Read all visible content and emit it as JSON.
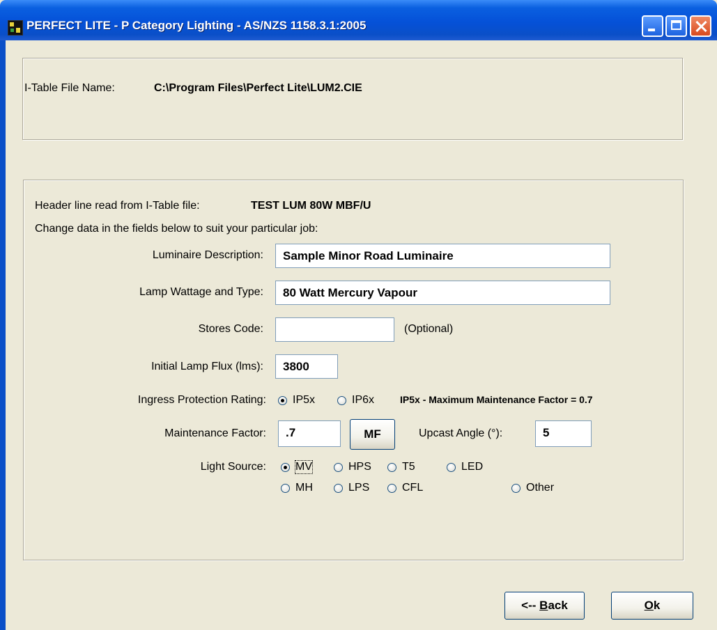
{
  "window": {
    "title": "PERFECT LITE - P Category Lighting - AS/NZS 1158.3.1:2005",
    "controls": {
      "minimize": "minimize-icon",
      "maximize": "maximize-icon",
      "close": "close-icon"
    }
  },
  "file_section": {
    "label": "I-Table File Name:",
    "path": "C:\\Program Files\\Perfect Lite\\LUM2.CIE"
  },
  "header_section": {
    "header_label": "Header line read from I-Table file:",
    "header_value": "TEST LUM 80W MBF/U",
    "instruction": "Change data in the fields below to suit your particular job:"
  },
  "form": {
    "luminaire_description": {
      "label": "Luminaire Description:",
      "value": "Sample Minor Road Luminaire"
    },
    "lamp_wattage": {
      "label": "Lamp Wattage and Type:",
      "value": "80 Watt Mercury Vapour"
    },
    "stores_code": {
      "label": "Stores Code:",
      "value": "",
      "hint": "(Optional)"
    },
    "initial_flux": {
      "label": "Initial Lamp Flux (lms):",
      "value": "3800"
    },
    "ingress": {
      "label": "Ingress Protection Rating:",
      "options": [
        "IP5x",
        "IP6x"
      ],
      "selected": "IP5x",
      "note": "IP5x - Maximum Maintenance Factor = 0.7"
    },
    "maintenance_factor": {
      "label": "Maintenance Factor:",
      "value": ".7",
      "button": "MF"
    },
    "upcast_angle": {
      "label": "Upcast Angle (°):",
      "value": "5"
    },
    "light_source": {
      "label": "Light Source:",
      "options": [
        "MV",
        "HPS",
        "T5",
        "LED",
        "MH",
        "LPS",
        "CFL",
        "Other"
      ],
      "selected": "MV"
    }
  },
  "buttons": {
    "back": {
      "prefix": "<-- ",
      "accel": "B",
      "rest": "ack"
    },
    "ok": {
      "accel": "O",
      "rest": "k"
    }
  },
  "colors": {
    "titlebar": "#0a5fe0",
    "face": "#ece9d8",
    "close": "#d84a1e"
  }
}
